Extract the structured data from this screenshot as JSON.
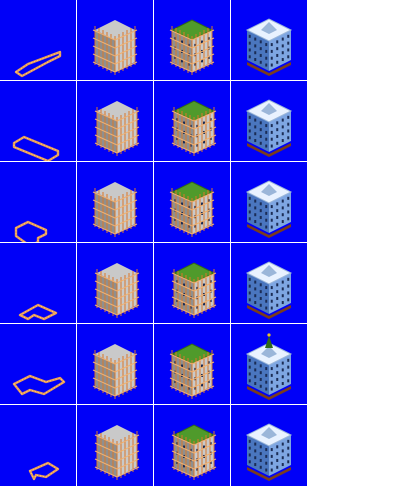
{
  "sheet": {
    "columns": 4,
    "rows": 6,
    "stages": [
      "foundation-icon",
      "scaffold-icon",
      "scaffold-roof-icon",
      "finished-building-icon"
    ],
    "footprints": [
      "long-rect",
      "rect",
      "l-left",
      "l-front",
      "wide-l",
      "l-back"
    ]
  },
  "colors": {
    "tile_bg": "#0000f8",
    "separator": "#ffffff",
    "foundation_edge": "#e89a56",
    "foundation_dot": "#ffd27a",
    "wall_left": "#8f8f8f",
    "wall_right": "#c9c9c9",
    "scaffold": "#d9782a",
    "scaffold_light": "#f0b070",
    "roof_green": "#4f9a2b",
    "roof_green_dark": "#2f6818",
    "facade_left": "#4a76bf",
    "facade_right": "#7ea6e2",
    "window": "#1b2c55",
    "roof_white": "#e9f2ff",
    "roof_shade": "#9bb6d9",
    "base_brown": "#7a3c1c",
    "gold": "#f0c020"
  }
}
